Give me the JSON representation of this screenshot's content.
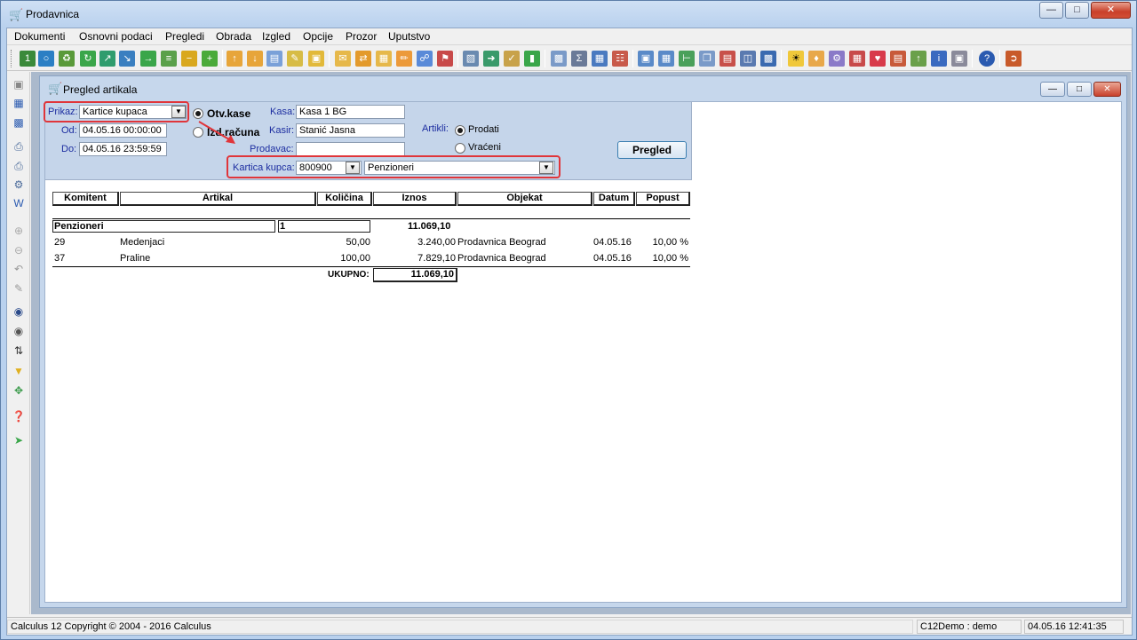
{
  "window": {
    "title": "Prodavnica",
    "controls": [
      "minimize",
      "maximize",
      "close"
    ]
  },
  "menu": [
    "Dokumenti",
    "Osnovni podaci",
    "Pregledi",
    "Obrada",
    "Izgled",
    "Opcije",
    "Prozor",
    "Uputstvo"
  ],
  "child": {
    "title": "Pregled artikala"
  },
  "form": {
    "prikaz_label": "Prikaz:",
    "prikaz_value": "Kartice kupaca",
    "od_label": "Od:",
    "od_value": "04.05.16 00:00:00",
    "do_label": "Do:",
    "do_value": "04.05.16 23:59:59",
    "otv_kase": "Otv.kase",
    "izd_racuna": "Izd.računa",
    "kasa_label": "Kasa:",
    "kasa_value": "Kasa 1 BG",
    "kasir_label": "Kasir:",
    "kasir_value": "Stanić Jasna",
    "prodavac_label": "Prodavac:",
    "prodavac_value": "",
    "artikli_label": "Artikli:",
    "prodati": "Prodati",
    "vraceni": "Vraćeni",
    "kartica_label": "Kartica kupca:",
    "kartica_code": "800900",
    "kartica_name": "Penzioneri",
    "pregled_button": "Pregled"
  },
  "report": {
    "headers": [
      "Komitent",
      "Artikal",
      "Količina",
      "Iznos",
      "Objekat",
      "Datum",
      "Popust"
    ],
    "group": {
      "name": "Penzioneri",
      "count": "1",
      "total": "11.069,10"
    },
    "rows": [
      {
        "komitent": "29",
        "artikal": "Medenjaci",
        "kolicina": "50,00",
        "iznos": "3.240,00",
        "objekat": "Prodavnica Beograd",
        "datum": "04.05.16",
        "popust": "10,00 %"
      },
      {
        "komitent": "37",
        "artikal": "Praline",
        "kolicina": "100,00",
        "iznos": "7.829,10",
        "objekat": "Prodavnica Beograd",
        "datum": "04.05.16",
        "popust": "10,00 %"
      }
    ],
    "ukupno_label": "UKUPNO:",
    "ukupno_value": "11.069,10"
  },
  "status": {
    "copyright": "Calculus 12  Copyright © 2004 - 2016  Calculus",
    "user": "C12Demo : demo",
    "datetime": "04.05.16 12:41:35"
  }
}
